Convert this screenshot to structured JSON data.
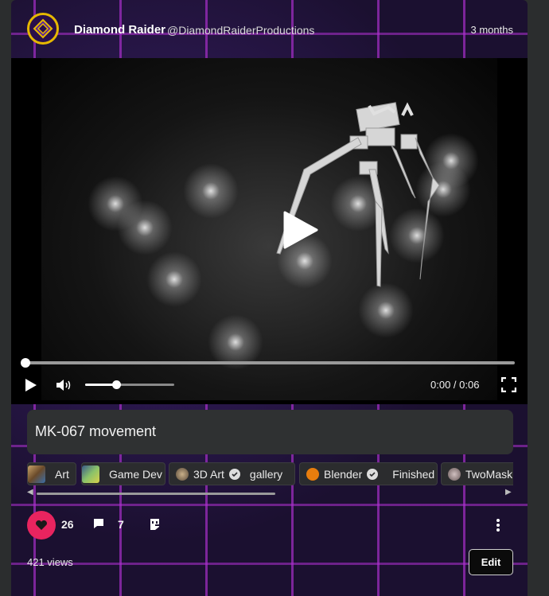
{
  "post": {
    "author_name": "Diamond Raider",
    "author_handle": "@DiamondRaiderProductions",
    "time_ago": "3 months",
    "title": "MK-067 movement",
    "views": "421 views",
    "edit_label": "Edit"
  },
  "video": {
    "timecode": "0:00 / 0:06",
    "progress": 0,
    "volume": 0.35
  },
  "tags": [
    {
      "label": "Art",
      "icon": "art-thumbnail"
    },
    {
      "label": "Game Dev",
      "icon": "game-dev-thumbnail"
    },
    {
      "label": "3D Art",
      "icon": "3d-art-thumbnail",
      "verified": true,
      "sub": "gallery"
    },
    {
      "label": "Blender",
      "icon": "blender-icon",
      "verified": true,
      "sub": "Finished"
    },
    {
      "label": "TwoMask S",
      "icon": "twomask-thumbnail"
    }
  ],
  "reactions": {
    "likes": "26",
    "comments": "7"
  },
  "colors": {
    "like": "#e8245f",
    "accent_grid": "#b030d2",
    "panel": "#2f3132"
  }
}
